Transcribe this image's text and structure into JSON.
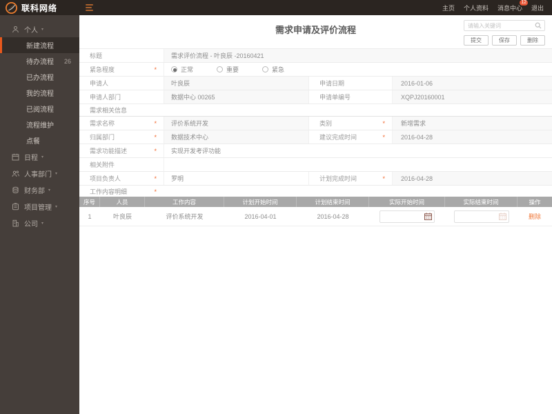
{
  "topbar": {
    "brand": "联科网络",
    "nav": [
      {
        "label": "主页"
      },
      {
        "label": "个人资料",
        "badge": ""
      },
      {
        "label": "消息中心",
        "badge": "12"
      },
      {
        "label": "退出"
      }
    ]
  },
  "sidebar": {
    "groups": [
      {
        "label": "个人"
      },
      {
        "label": "日程"
      },
      {
        "label": "人事部门"
      },
      {
        "label": "财务部"
      },
      {
        "label": "项目管理"
      },
      {
        "label": "公司"
      }
    ],
    "personal_items": [
      {
        "label": "新建流程",
        "badge": ""
      },
      {
        "label": "待办流程",
        "badge": "26"
      },
      {
        "label": "已办流程",
        "badge": ""
      },
      {
        "label": "我的流程",
        "badge": ""
      },
      {
        "label": "已阅流程",
        "badge": ""
      },
      {
        "label": "流程维护",
        "badge": ""
      },
      {
        "label": "点餐",
        "badge": ""
      }
    ]
  },
  "main": {
    "title": "需求申请及评价流程",
    "search": {
      "placeholder": "请输入关键词"
    },
    "actions": {
      "submit": "提交",
      "save": "保存",
      "delete": "删除"
    },
    "form": {
      "title_label": "标题",
      "title_value": "需求评价流程 - 叶良辰 -20160421",
      "urgency_label": "紧急程度",
      "urgency_options": [
        "正常",
        "重要",
        "紧急"
      ],
      "urgency_selected": "正常",
      "applicant_label": "申请人",
      "applicant_value": "叶良辰",
      "apply_date_label": "申请日期",
      "apply_date_value": "2016-01-06",
      "dept_label": "申请人部门",
      "dept_value": "数据中心 00265",
      "apply_no_label": "申请单编号",
      "apply_no_value": "XQPJ20160001",
      "section_requirement": "需求相关信息",
      "req_name_label": "需求名称",
      "req_name_value": "评价系统开发",
      "category_label": "类别",
      "category_value": "新增需求",
      "owner_dept_label": "归属部门",
      "owner_dept_value": "数据技术中心",
      "suggest_finish_label": "建议完成时间",
      "suggest_finish_value": "2016-04-28",
      "req_desc_label": "需求功能描述",
      "req_desc_value": "实现开发考评功能",
      "attachment_label": "相关附件",
      "attachment_value": "",
      "leader_label": "项目负责人",
      "leader_value": "罗明",
      "plan_finish_label": "计划完成时间",
      "plan_finish_value": "2016-04-28",
      "section_work": "工作内容明细"
    },
    "table": {
      "headers": [
        "序号",
        "人员",
        "工作内容",
        "计划开始时间",
        "计划结束时间",
        "实际开始时间",
        "实际结束时间",
        "操作"
      ],
      "rows": [
        {
          "no": "1",
          "person": "叶良辰",
          "content": "评价系统开发",
          "plan_start": "2016-04-01",
          "plan_end": "2016-04-28",
          "actual_start": "",
          "actual_end": "",
          "action": "删除"
        }
      ]
    }
  }
}
